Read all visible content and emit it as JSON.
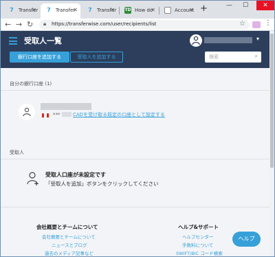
{
  "browser": {
    "tabs": [
      {
        "label": "Transfer",
        "icon": "transferwise-icon",
        "active": false
      },
      {
        "label": "Transfer",
        "icon": "transferwise-icon",
        "active": true
      },
      {
        "label": "Transfer",
        "icon": "transferwise-icon",
        "active": false
      },
      {
        "label": "How do",
        "icon": "td-icon",
        "active": false
      },
      {
        "label": "Account",
        "icon": "document-icon",
        "active": false
      }
    ],
    "url": "https://transferwise.com/user/recipients/list",
    "new_tab": "+",
    "minimize": "—",
    "maximize": "☐",
    "close": "✕"
  },
  "header": {
    "title": "受取人一覧",
    "add_bank_button": "銀行口座を追加する",
    "add_recipient_button": "受取人を追加する",
    "search_placeholder": "検索"
  },
  "own_accounts": {
    "label": "自分の銀行口座 (1)",
    "account_mask": "***",
    "set_default_link": "CADを受け取る既定の口座として設定する"
  },
  "recipients": {
    "label": "受取人",
    "empty_title": "受取人口座が未設定です",
    "empty_desc": "「受取人を追加」ボタンをクリックしてください"
  },
  "footer": {
    "about": {
      "heading": "会社概要とチームについて",
      "links": [
        "会社概要とチームについて",
        "ニュースとブログ",
        "過去のメディア記事など"
      ]
    },
    "help": {
      "heading": "ヘルプ&サポート",
      "links": [
        "ヘルプセンター",
        "手数料について",
        "SWIFT/BIC コード検索"
      ]
    }
  },
  "help_button": "ヘルプ",
  "colors": {
    "header_bg": "#2c3e5c",
    "accent": "#37a0d8"
  }
}
